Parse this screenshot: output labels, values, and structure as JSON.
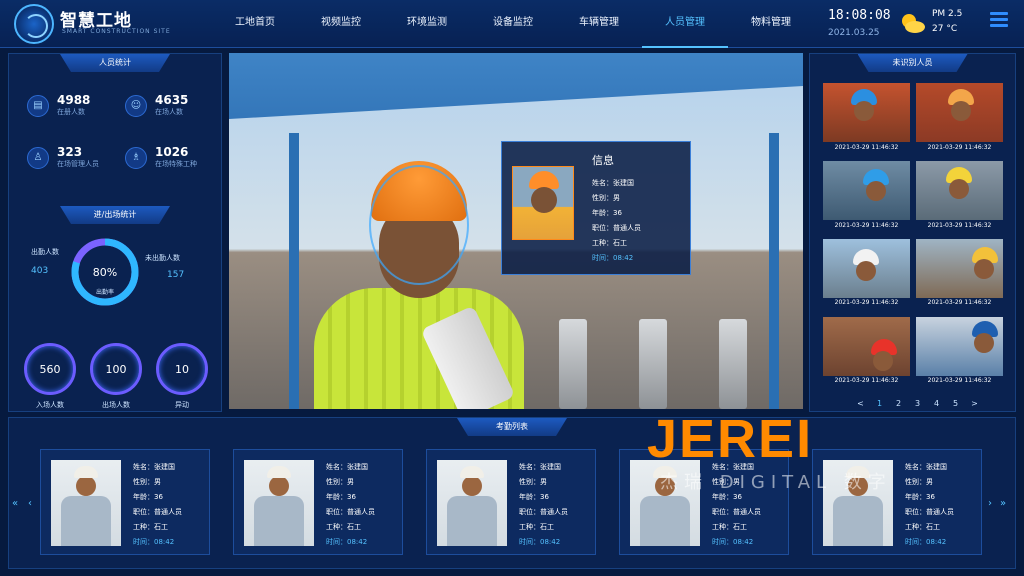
{
  "header": {
    "brand": "智慧工地",
    "brand_sub": "SMART CONSTRUCTION SITE",
    "nav": [
      "工地首页",
      "视频监控",
      "环境监测",
      "设备监控",
      "车辆管理",
      "人员管理",
      "物料管理"
    ],
    "active_nav": "人员管理",
    "time": "18:08:08",
    "date": "2021.03.25",
    "pm": "PM 2.5",
    "temp": "27 °C"
  },
  "people_stats": {
    "title": "人员统计",
    "items": [
      {
        "value": "4988",
        "label": "在册人数",
        "icon": "clipboard-icon"
      },
      {
        "value": "4635",
        "label": "在场人数",
        "icon": "person-icon"
      },
      {
        "value": "323",
        "label": "在场管理人员",
        "icon": "manager-icon"
      },
      {
        "value": "1026",
        "label": "在场特殊工种",
        "icon": "worker-icon"
      }
    ]
  },
  "attendance": {
    "title": "进/出场统计",
    "present_label": "出勤人数",
    "present_value": "403",
    "absent_label": "未出勤人数",
    "absent_value": "157",
    "rate": "80%",
    "rate_label": "出勤率",
    "circles": [
      {
        "value": "560",
        "label": "入场人数"
      },
      {
        "value": "100",
        "label": "出场人数"
      },
      {
        "value": "10",
        "label": "异动"
      }
    ]
  },
  "live": {
    "info_title": "信息",
    "name": "姓名：张建国",
    "gender": "性别：男",
    "age": "年龄：36",
    "role": "职位：普通人员",
    "type": "工种：石工",
    "time": "时间：08:42"
  },
  "unknown": {
    "title": "未识别人员",
    "items": [
      {
        "time": "2021-03-29 11:46:32"
      },
      {
        "time": "2021-03-29 11:46:32"
      },
      {
        "time": "2021-03-29 11:46:32"
      },
      {
        "time": "2021-03-29 11:46:32"
      },
      {
        "time": "2021-03-29 11:46:32"
      },
      {
        "time": "2021-03-29 11:46:32"
      },
      {
        "time": "2021-03-29 11:46:32"
      },
      {
        "time": "2021-03-29 11:46:32"
      }
    ],
    "pages": [
      "<",
      "1",
      "2",
      "3",
      "4",
      "5",
      ">"
    ]
  },
  "attendance_list": {
    "title": "考勤列表",
    "cards": [
      {
        "name": "姓名：张建国",
        "gender": "性别：男",
        "age": "年龄：36",
        "role": "职位：普通人员",
        "type": "工种：石工",
        "time": "时间：08:42"
      },
      {
        "name": "姓名：张建国",
        "gender": "性别：男",
        "age": "年龄：36",
        "role": "职位：普通人员",
        "type": "工种：石工",
        "time": "时间：08:42"
      },
      {
        "name": "姓名：张建国",
        "gender": "性别：男",
        "age": "年龄：36",
        "role": "职位：普通人员",
        "type": "工种：石工",
        "time": "时间：08:42"
      },
      {
        "name": "姓名：张建国",
        "gender": "性别：男",
        "age": "年龄：36",
        "role": "职位：普通人员",
        "type": "工种：石工",
        "time": "时间：08:42"
      },
      {
        "name": "姓名：张建国",
        "gender": "性别：男",
        "age": "年龄：36",
        "role": "职位：普通人员",
        "type": "工种：石工",
        "time": "时间：08:42"
      }
    ]
  },
  "watermark": {
    "main": "JEREI",
    "sub": "杰瑞 DIGITAL 数字"
  },
  "colors": {
    "accent": "#55c2ff",
    "bg": "#061a3f",
    "panel": "#0a2250",
    "warning": "#ff8a00"
  }
}
